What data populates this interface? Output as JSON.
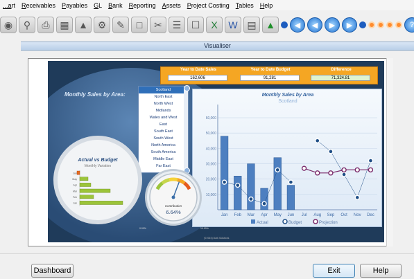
{
  "menu": [
    "...art",
    "Receivables",
    "Payables",
    "GL",
    "Bank",
    "Reporting",
    "Assets",
    "Project Costing",
    "Tables",
    "Help"
  ],
  "window_title": "Visualiser",
  "dashboard": {
    "ytd_sales_label": "Year to Date Sales",
    "ytd_sales_value": "162,606",
    "ytd_budget_label": "Year to Date Budget",
    "ytd_budget_value": "91,281",
    "difference_label": "Difference",
    "difference_value": "71,324.81",
    "monthly_sales_by_area": "Monthly Sales by Area:",
    "areas": [
      "Scotland",
      "North East",
      "North West",
      "Midlands",
      "Wales and West",
      "East",
      "South East",
      "South West",
      "North America",
      "South America",
      "Middle East",
      "Far East"
    ],
    "selected_area": "Scotland",
    "actual_vs_budget_title": "Actual vs Budget",
    "actual_vs_budget_sub": "Monthly Variation",
    "contribution_label": "Contribution",
    "contribution_value": "6.64%",
    "gauge_min": "0.00%",
    "gauge_max": "10.00%",
    "footnote": "(©2010) Dark Solutions"
  },
  "chart_data": {
    "type": "bar",
    "title": "Monthly Sales by Area",
    "subtitle": "Scotland",
    "categories": [
      "Jan",
      "Feb",
      "Mar",
      "Apr",
      "May",
      "Jun",
      "Jul",
      "Aug",
      "Sep",
      "Oct",
      "Nov",
      "Dec"
    ],
    "y_ticks": [
      "10,000",
      "20,000",
      "30,000",
      "40,000",
      "50,000",
      "60,000"
    ],
    "ylim": [
      0,
      65000
    ],
    "series": [
      {
        "name": "Actual",
        "type": "bar",
        "color": "#4d7fc0",
        "values": [
          48000,
          22000,
          30000,
          14000,
          34000,
          16000,
          null,
          null,
          null,
          null,
          null,
          null
        ]
      },
      {
        "name": "Budget",
        "type": "line",
        "color": "#1f4e86",
        "values": [
          18000,
          16000,
          7000,
          4000,
          26000,
          18000,
          null,
          45000,
          38000,
          23000,
          8000,
          32000
        ]
      },
      {
        "name": "Projection",
        "type": "line",
        "color": "#7a2a6a",
        "values": [
          null,
          null,
          null,
          null,
          null,
          null,
          27000,
          24000,
          24000,
          26000,
          26000,
          26000
        ]
      }
    ],
    "legend": [
      "Actual",
      "Budget",
      "Projection"
    ]
  },
  "mini_chart": {
    "type": "bar",
    "categories": [
      "Jun",
      "May",
      "Apr",
      "Mar",
      "Feb",
      "Jan"
    ],
    "values": [
      -2000,
      6000,
      8000,
      22000,
      10000,
      31000
    ]
  },
  "buttons": {
    "dashboard": "Dashboard",
    "exit": "Exit",
    "help": "Help"
  }
}
